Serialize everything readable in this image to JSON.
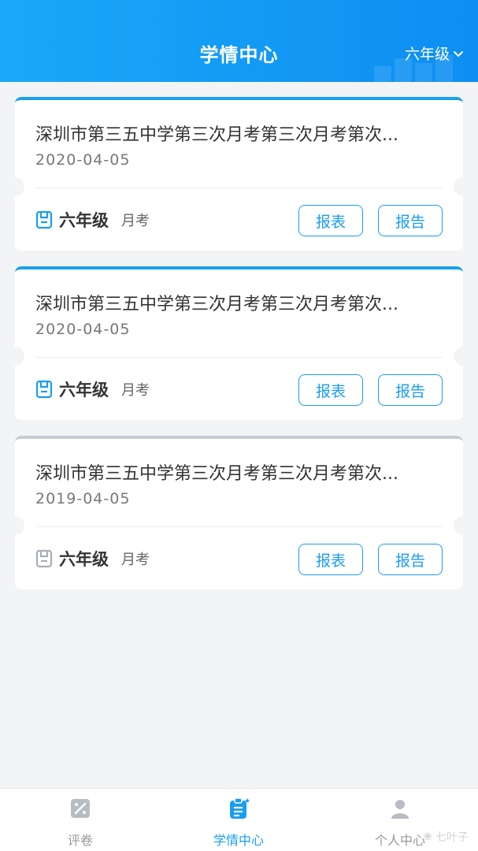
{
  "header": {
    "title": "学情中心",
    "grade_select": "六年级"
  },
  "records": [
    {
      "title": "深圳市第三五中学第三次月考第三次月考第次...",
      "date": "2020-04-05",
      "grade": "六年级",
      "type": "月考",
      "btn_table": "报表",
      "btn_report": "报告",
      "accent": "#1aa0ee"
    },
    {
      "title": "深圳市第三五中学第三次月考第三次月考第次...",
      "date": "2020-04-05",
      "grade": "六年级",
      "type": "月考",
      "btn_table": "报表",
      "btn_report": "报告",
      "accent": "#1aa0ee"
    },
    {
      "title": "深圳市第三五中学第三次月考第三次月考第次...",
      "date": "2019-04-05",
      "grade": "六年级",
      "type": "月考",
      "btn_table": "报表",
      "btn_report": "报告",
      "accent": "#c9ccd3"
    }
  ],
  "tabbar": {
    "items": [
      {
        "label": "评卷",
        "icon": "grading-icon",
        "active": false
      },
      {
        "label": "学情中心",
        "icon": "clipboard-icon",
        "active": true
      },
      {
        "label": "个人中心",
        "icon": "person-icon",
        "active": false
      }
    ]
  },
  "watermark": "七叶子"
}
